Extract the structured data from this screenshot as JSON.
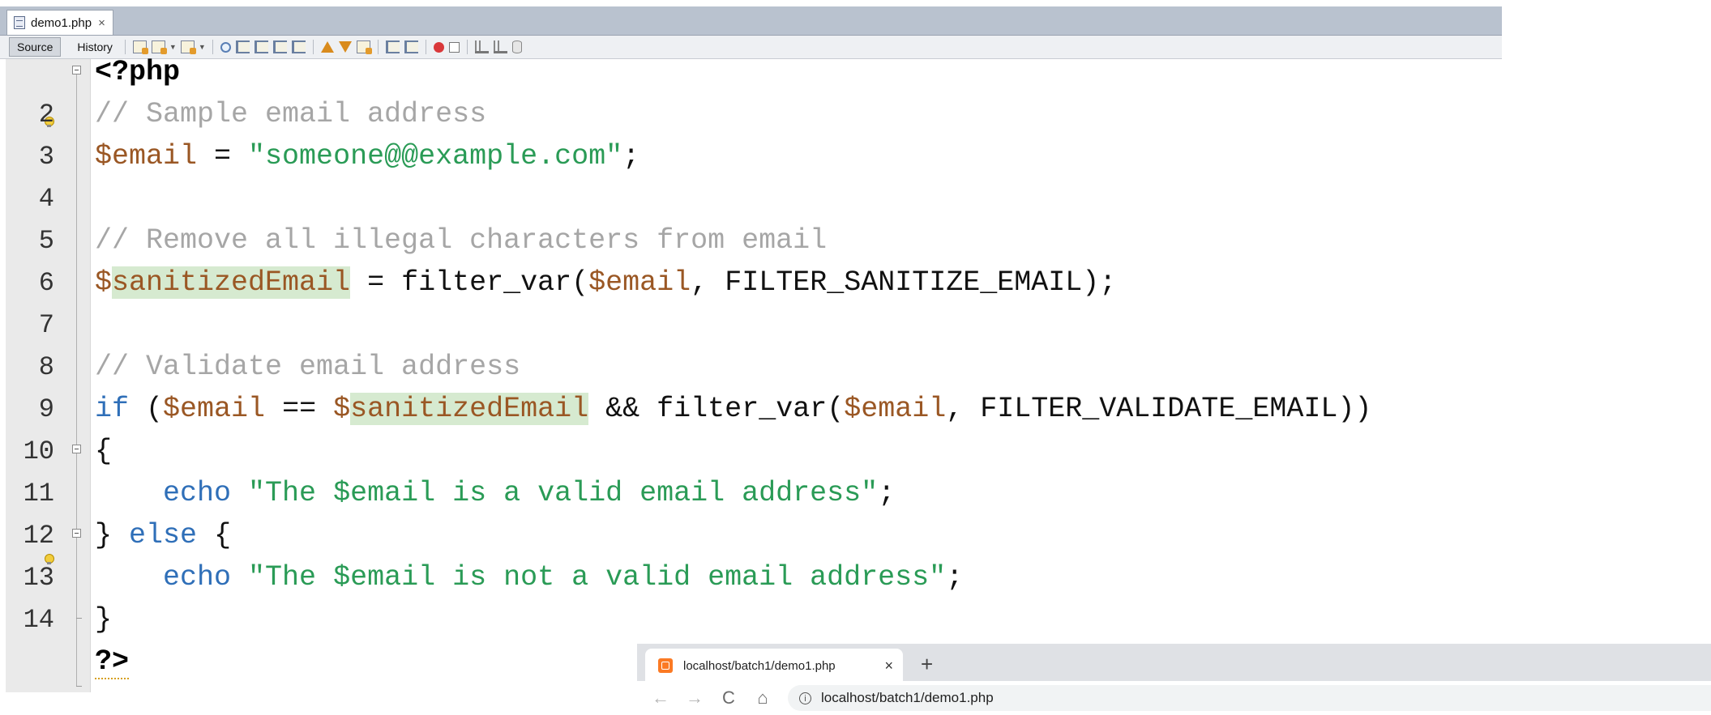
{
  "ide": {
    "tab": {
      "label": "demo1.php",
      "close": "×"
    },
    "views": [
      {
        "label": "Source",
        "active": true
      },
      {
        "label": "History",
        "active": false
      }
    ]
  },
  "editor": {
    "line_numbers": [
      "",
      "2",
      "3",
      "4",
      "5",
      "6",
      "7",
      "8",
      "9",
      "10",
      "11",
      "12",
      "13",
      "14",
      ""
    ],
    "code": {
      "open_tag": "<?php",
      "comment1": "// Sample email address",
      "var_email": "$email",
      "assign": " = ",
      "email_value": "\"someone@@example.com\"",
      "semicolon": ";",
      "comment2": "// Remove all illegal characters from email",
      "dollar": "$",
      "sanitized": "sanitizedEmail",
      "call_sanitize": "filter_var(",
      "comma": ", ",
      "const_sanitize": "FILTER_SANITIZE_EMAIL",
      "close_call": ");",
      "comment3": "// Validate email address",
      "kw_if": "if",
      "if_open": " (",
      "eq": " == ",
      "and": " && ",
      "call_validate": "filter_var(",
      "const_validate": "FILTER_VALIDATE_EMAIL",
      "if_close": "))",
      "brace_open": "{",
      "indent": "    ",
      "kw_echo": "echo",
      "space": " ",
      "str_valid": "\"The $email is a valid email address\"",
      "brace_close": "}",
      "kw_else": "else",
      "str_invalid": "\"The $email is not a valid email address\"",
      "close_tag": "?>"
    }
  },
  "browser": {
    "tab_title": "localhost/batch1/demo1.php",
    "tab_close": "×",
    "new_tab": "+",
    "url": "localhost/batch1/demo1.php",
    "nav": {
      "back": "←",
      "forward": "→",
      "reload": "C",
      "home": "⌂",
      "info": "i"
    }
  },
  "colors": {
    "comment": "#a6a6a6",
    "variable": "#9a5724",
    "string": "#2a9b56",
    "keyword": "#2f6fb8",
    "highlight": "#d6ead0"
  }
}
